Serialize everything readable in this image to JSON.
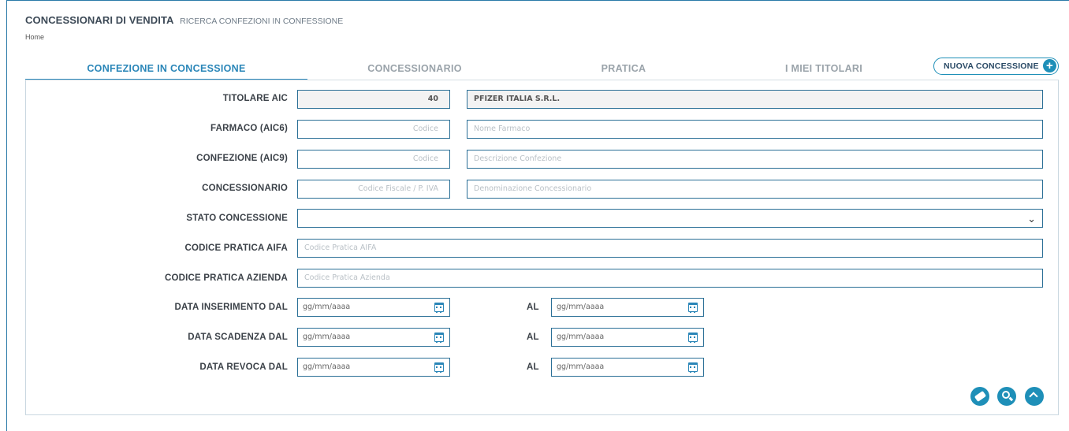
{
  "header": {
    "title": "CONCESSIONARI DI VENDITA",
    "subtitle": "RICERCA CONFEZIONI IN CONFESSIONE",
    "breadcrumb": "Home"
  },
  "tabs": [
    {
      "label": "CONFEZIONE IN CONCESSIONE",
      "active": true
    },
    {
      "label": "CONCESSIONARIO",
      "active": false
    },
    {
      "label": "PRATICA",
      "active": false
    },
    {
      "label": "I MIEI TITOLARI",
      "active": false
    }
  ],
  "new_button": {
    "label": "NUOVA CONCESSIONE",
    "icon": "plus-circle-icon"
  },
  "form": {
    "titolare": {
      "label": "TITOLARE AIC",
      "code": "40",
      "name": "PFIZER ITALIA S.R.L."
    },
    "farmaco": {
      "label": "FARMACO (AIC6)",
      "code_placeholder": "Codice",
      "name_placeholder": "Nome Farmaco"
    },
    "confezione": {
      "label": "CONFEZIONE (AIC9)",
      "code_placeholder": "Codice",
      "desc_placeholder": "Descrizione Confezione"
    },
    "concessionario": {
      "label": "CONCESSIONARIO",
      "code_placeholder": "Codice Fiscale / P. IVA",
      "name_placeholder": "Denominazione Concessionario"
    },
    "stato": {
      "label": "STATO CONCESSIONE",
      "value": ""
    },
    "pratica_aifa": {
      "label": "CODICE PRATICA AIFA",
      "placeholder": "Codice Pratica AIFA"
    },
    "pratica_azienda": {
      "label": "CODICE PRATICA AZIENDA",
      "placeholder": "Codice Pratica Azienda"
    },
    "data_inserimento": {
      "label": "DATA INSERIMENTO DAL",
      "to_label": "AL",
      "from_placeholder": "gg/mm/aaaa",
      "to_placeholder": "gg/mm/aaaa"
    },
    "data_scadenza": {
      "label": "DATA SCADENZA DAL",
      "to_label": "AL",
      "from_placeholder": "gg/mm/aaaa",
      "to_placeholder": "gg/mm/aaaa"
    },
    "data_revoca": {
      "label": "DATA REVOCA DAL",
      "to_label": "AL",
      "from_placeholder": "gg/mm/aaaa",
      "to_placeholder": "gg/mm/aaaa"
    }
  },
  "actions": {
    "clear_icon": "eraser-icon",
    "search_icon": "search-icon",
    "collapse_icon": "chevron-up-icon"
  },
  "colors": {
    "accent": "#1e8fb8",
    "border": "#2a6f96"
  }
}
